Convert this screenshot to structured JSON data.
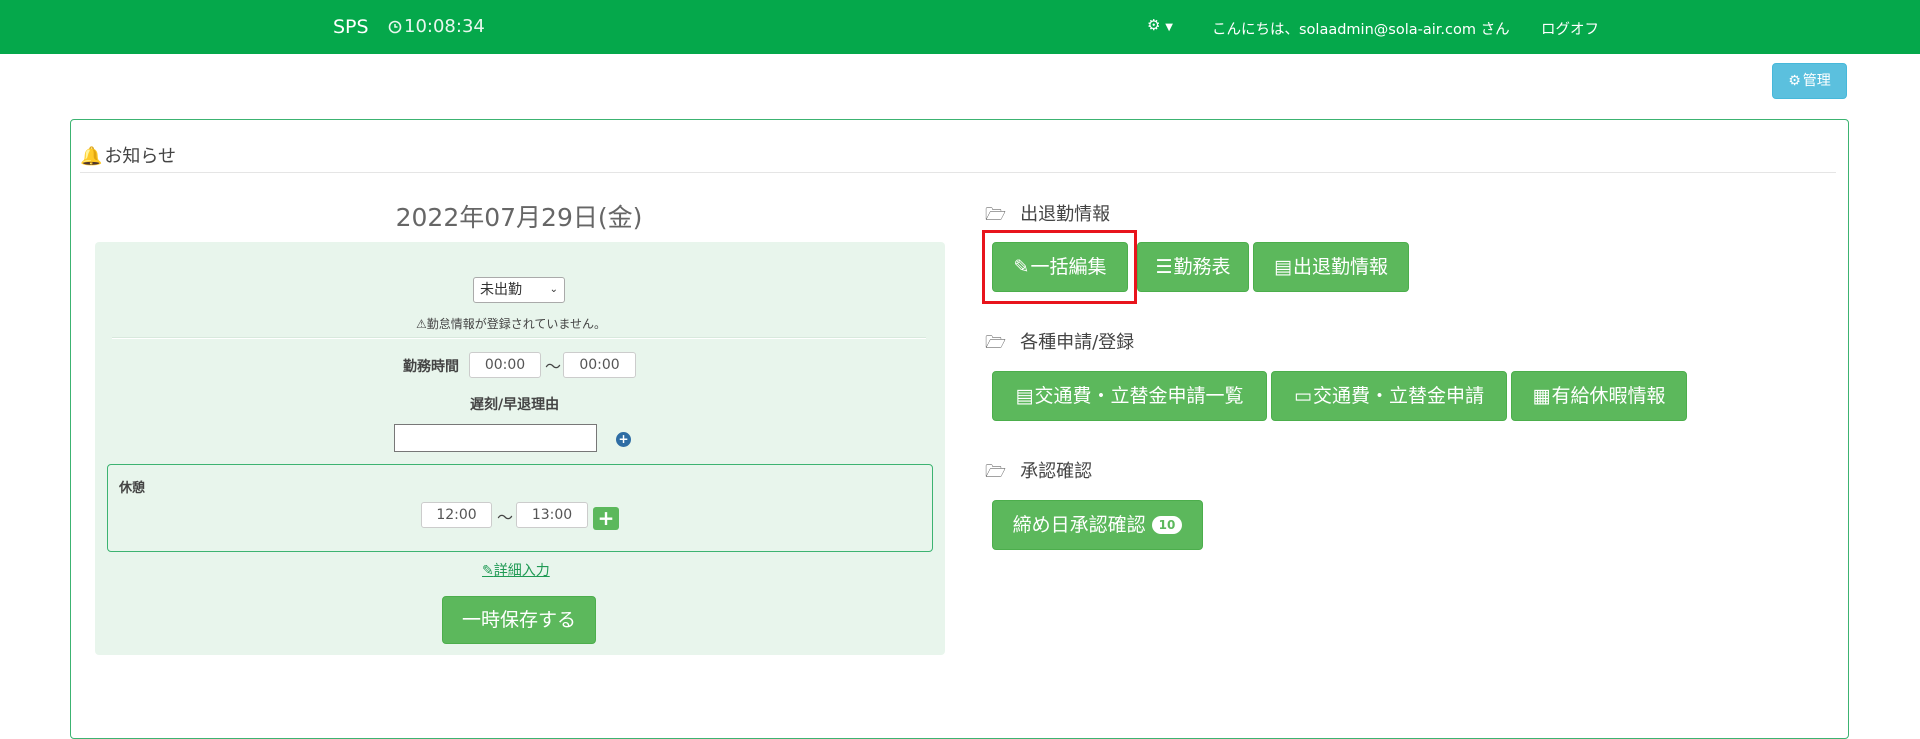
{
  "navbar": {
    "brand": "SPS",
    "clock": "10:08:34",
    "greeting": "こんにちは、solaadmin@sola-air.com さん",
    "logoff": "ログオフ",
    "bg_color": "#05a84b"
  },
  "admin_button": "管理",
  "notice": {
    "title": "お知らせ"
  },
  "attendance": {
    "date": "2022年07月29日(金)",
    "status_selected": "未出勤",
    "warning": "勤怠情報が登録されていません。",
    "work_time_label": "勤務時間",
    "start_placeholder": "00:00",
    "end_placeholder": "00:00",
    "tilde": "〜",
    "reason_label": "遅刻/早退理由",
    "break_label": "休憩",
    "break_start": "12:00",
    "break_end": "13:00",
    "detail_link": "詳細入力",
    "save_button": "一時保存する"
  },
  "sections": {
    "attendance_info": {
      "title": "出退勤情報",
      "buttons": [
        "一括編集",
        "勤務表",
        "出退勤情報"
      ]
    },
    "applications": {
      "title": "各種申請/登録",
      "buttons": [
        "交通費・立替金申請一覧",
        "交通費・立替金申請",
        "有給休暇情報"
      ]
    },
    "approval": {
      "title": "承認確認",
      "button": "締め日承認確認",
      "badge": "10"
    }
  },
  "colors": {
    "accent": "#05a84b",
    "button": "#5cb85c",
    "info": "#5bc0de",
    "highlight": "#e8141c"
  }
}
